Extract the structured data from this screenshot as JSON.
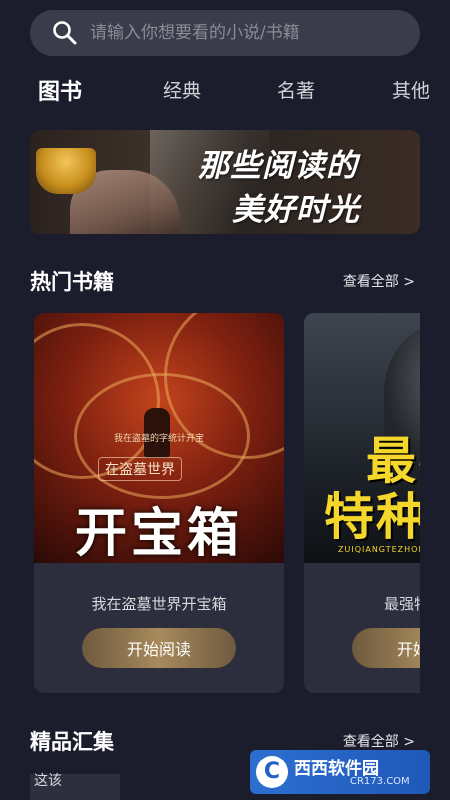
{
  "search": {
    "placeholder": "请输入你想要看的小说/书籍"
  },
  "tabs": [
    {
      "label": "图书",
      "active": true
    },
    {
      "label": "经典",
      "active": false
    },
    {
      "label": "名著",
      "active": false
    },
    {
      "label": "其他",
      "active": false
    }
  ],
  "banner": {
    "line1": "那些阅读的",
    "line2": "美好时光"
  },
  "hot_section": {
    "title": "热门书籍",
    "more": "查看全部 >"
  },
  "books": [
    {
      "name": "我在盗墓世界开宝箱",
      "button": "开始阅读",
      "cover_small": "我在盗墓的字统计开宝",
      "cover_sub": "在盗墓世界",
      "cover_title": "开宝箱"
    },
    {
      "name": "最强特种兵",
      "button": "开始阅读",
      "cover_title_line1": "最强",
      "cover_title_line2": "特种兵",
      "cover_pinyin": "ZUIQIANGTEZHONGBING"
    }
  ],
  "featured_section": {
    "title": "精品汇集",
    "more": "查看全部 >"
  },
  "featured_items": [
    {
      "label": "这该"
    }
  ],
  "watermark": {
    "brand": "西西软件园",
    "domain": "CR173.COM",
    "logo": "C"
  },
  "colors": {
    "background": "#1b1c2c",
    "card": "#2c2d3d",
    "accent_gold": "#a88a5c",
    "search_bg": "#3a3c4b"
  }
}
